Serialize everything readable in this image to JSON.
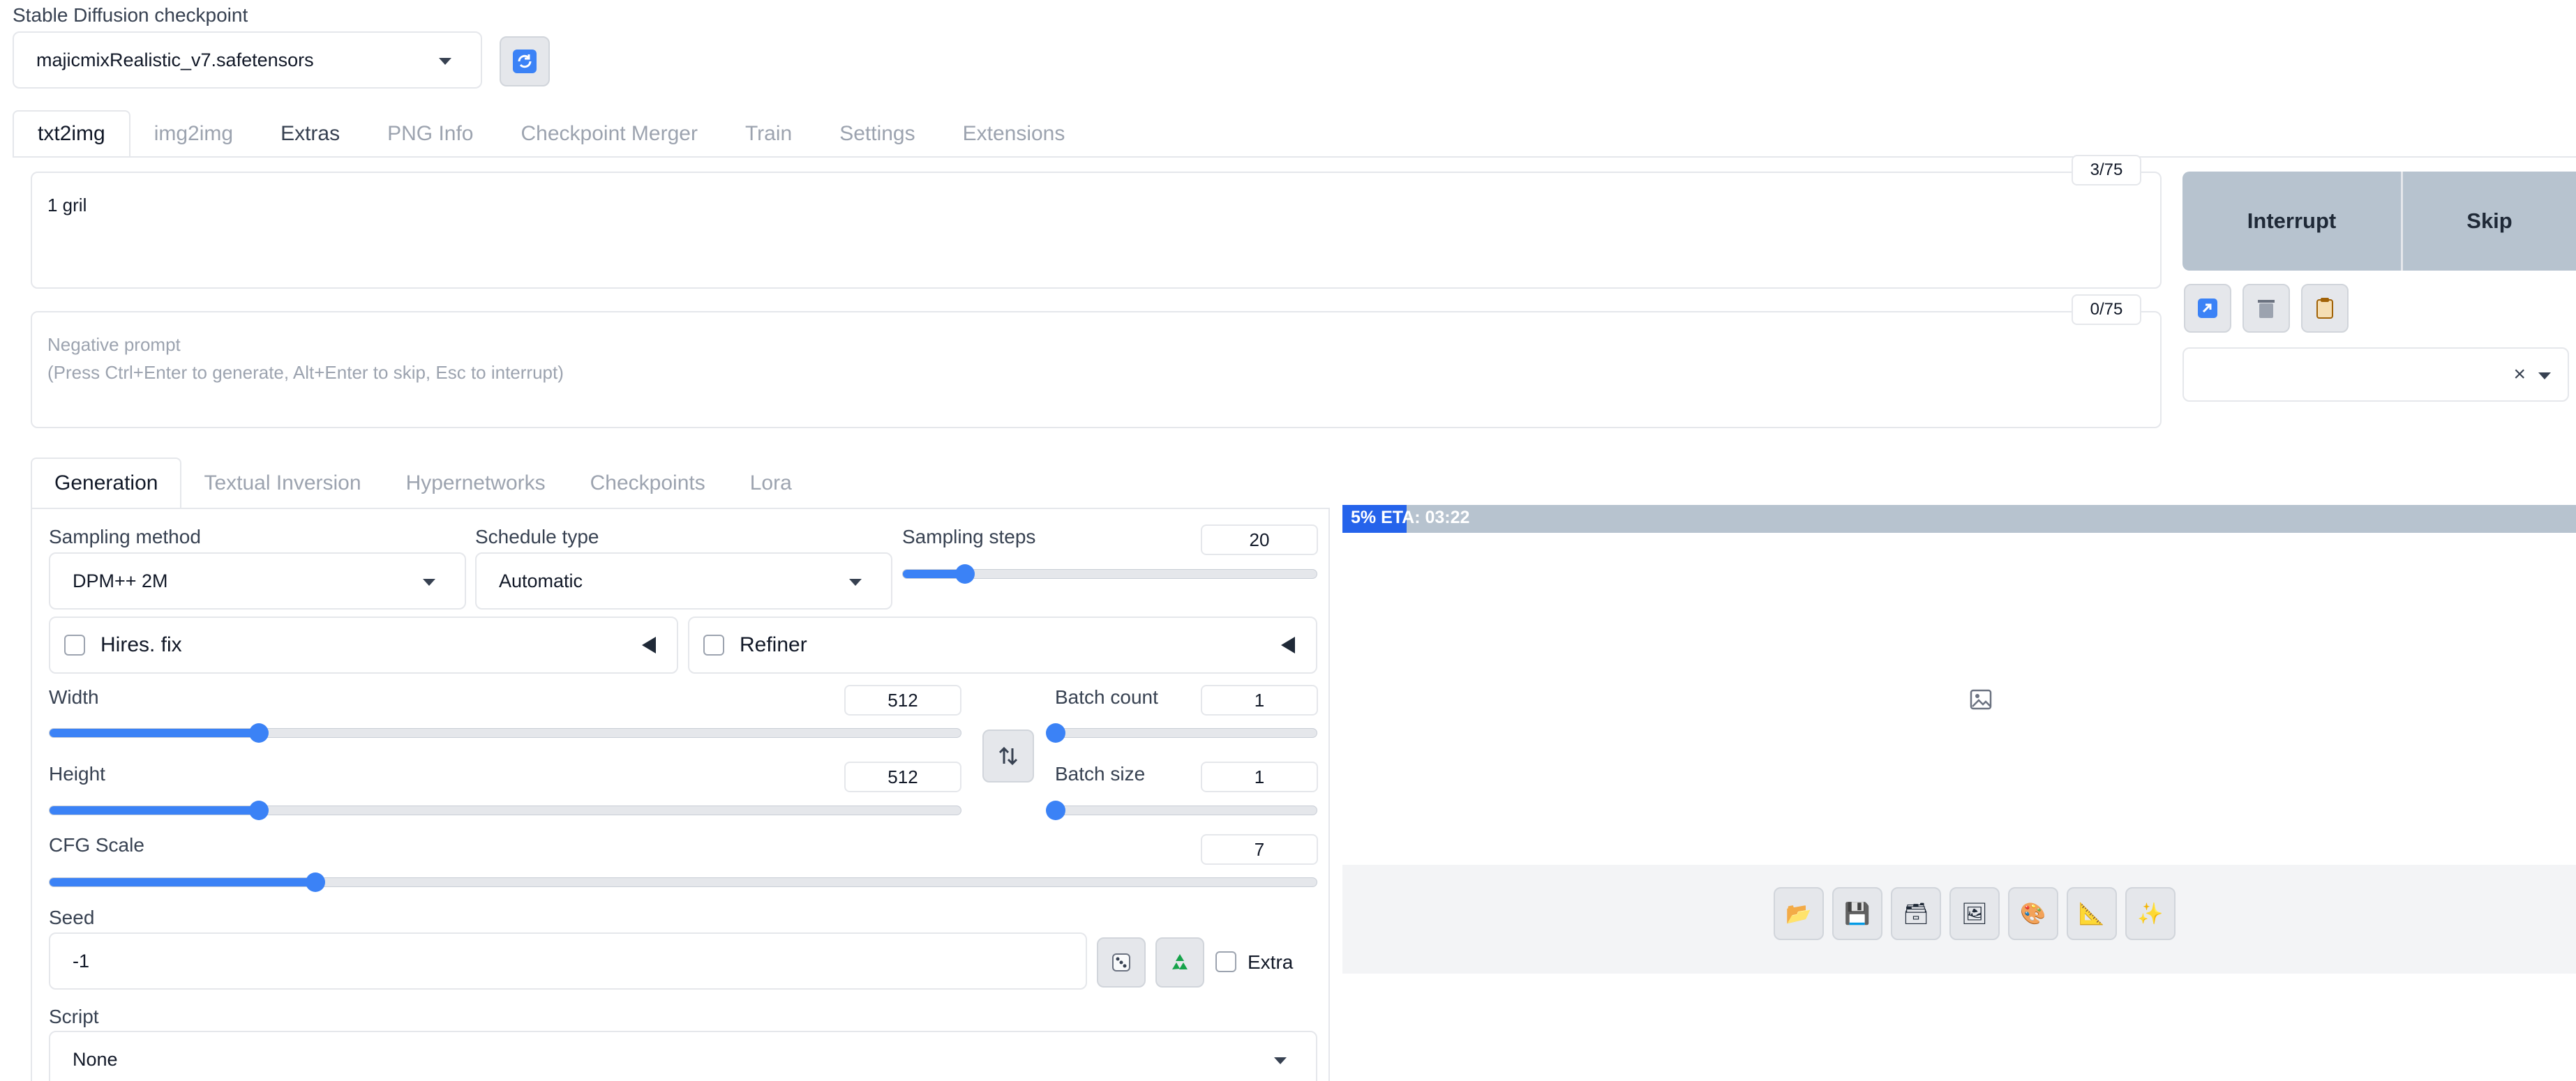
{
  "checkpoint": {
    "label": "Stable Diffusion checkpoint",
    "value": "majicmixRealistic_v7.safetensors",
    "refresh_icon": "refresh-icon"
  },
  "main_tabs": [
    "txt2img",
    "img2img",
    "Extras",
    "PNG Info",
    "Checkpoint Merger",
    "Train",
    "Settings",
    "Extensions"
  ],
  "prompt": {
    "text": "1 gril",
    "counter": "3/75"
  },
  "negative_prompt": {
    "placeholder_line1": "Negative prompt",
    "placeholder_line2": "(Press Ctrl+Enter to generate, Alt+Enter to skip, Esc to interrupt)",
    "counter": "0/75"
  },
  "actions": {
    "interrupt": "Interrupt",
    "skip": "Skip",
    "tools": [
      "paste-icon",
      "trash-icon",
      "clipboard-icon"
    ],
    "styles_clear": "×"
  },
  "sub_tabs": [
    "Generation",
    "Textual Inversion",
    "Hypernetworks",
    "Checkpoints",
    "Lora"
  ],
  "generation": {
    "sampling_method": {
      "label": "Sampling method",
      "value": "DPM++ 2M"
    },
    "schedule_type": {
      "label": "Schedule type",
      "value": "Automatic"
    },
    "sampling_steps": {
      "label": "Sampling steps",
      "value": "20",
      "fraction": 0.15
    },
    "hires_fix": "Hires. fix",
    "refiner": "Refiner",
    "width": {
      "label": "Width",
      "value": "512",
      "fraction": 0.23
    },
    "height": {
      "label": "Height",
      "value": "512",
      "fraction": 0.23
    },
    "batch_count": {
      "label": "Batch count",
      "value": "1",
      "fraction": 0.0
    },
    "batch_size": {
      "label": "Batch size",
      "value": "1",
      "fraction": 0.0
    },
    "cfg_scale": {
      "label": "CFG Scale",
      "value": "7",
      "fraction": 0.21
    },
    "seed": {
      "label": "Seed",
      "value": "-1",
      "extra_label": "Extra"
    },
    "script": {
      "label": "Script",
      "value": "None"
    }
  },
  "output": {
    "progress_text": "5% ETA: 03:22",
    "progress_fraction": 0.05,
    "placeholder_icon": "image-icon",
    "toolbar_icons": [
      "folder-icon",
      "save-icon",
      "zip-icon",
      "send-to-img2img-icon",
      "send-to-inpaint-icon",
      "send-to-extras-icon",
      "sparkle-icon"
    ]
  },
  "colors": {
    "accent": "#3b82f6",
    "progress_fill": "#2563eb",
    "action_bg": "#b7c3cf"
  }
}
